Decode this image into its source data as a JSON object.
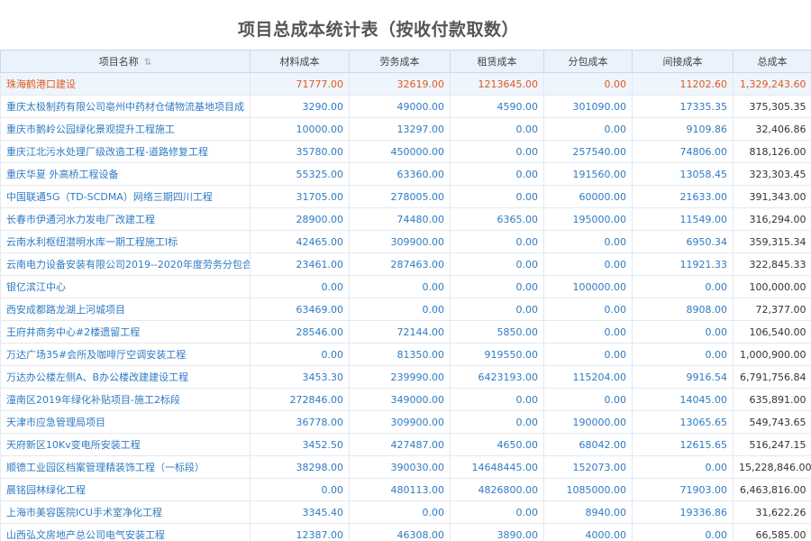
{
  "title": "项目总成本统计表（按收付款取数）",
  "columns": {
    "name": "项目名称",
    "material": "材料成本",
    "labor": "劳务成本",
    "rent": "租赁成本",
    "subcontract": "分包成本",
    "indirect": "间接成本",
    "total": "总成本"
  },
  "sort_icon": "sort-icon",
  "colors": {
    "link": "#2f7bc4",
    "highlight": "#e05a1e",
    "header_bg": "#eaf2fb"
  },
  "rows": [
    {
      "name": "珠海鹤港口建设",
      "material": "71777.00",
      "labor": "32619.00",
      "rent": "1213645.00",
      "subcontract": "0.00",
      "indirect": "11202.60",
      "total": "1,329,243.60",
      "highlight": true
    },
    {
      "name": "重庆太极制药有限公司亳州中药材仓储物流基地项目成",
      "material": "3290.00",
      "labor": "49000.00",
      "rent": "4590.00",
      "subcontract": "301090.00",
      "indirect": "17335.35",
      "total": "375,305.35"
    },
    {
      "name": "重庆市鹅岭公园绿化景观提升工程施工",
      "material": "10000.00",
      "labor": "13297.00",
      "rent": "0.00",
      "subcontract": "0.00",
      "indirect": "9109.86",
      "total": "32,406.86"
    },
    {
      "name": "重庆江北污水处理厂级改造工程-道路修复工程",
      "material": "35780.00",
      "labor": "450000.00",
      "rent": "0.00",
      "subcontract": "257540.00",
      "indirect": "74806.00",
      "total": "818,126.00"
    },
    {
      "name": "重庆华夏 外高桥工程设备",
      "material": "55325.00",
      "labor": "63360.00",
      "rent": "0.00",
      "subcontract": "191560.00",
      "indirect": "13058.45",
      "total": "323,303.45"
    },
    {
      "name": "中国联通5G（TD-SCDMA）网络三期四川工程",
      "material": "31705.00",
      "labor": "278005.00",
      "rent": "0.00",
      "subcontract": "60000.00",
      "indirect": "21633.00",
      "total": "391,343.00"
    },
    {
      "name": "长春市伊通河水力发电厂改建工程",
      "material": "28900.00",
      "labor": "74480.00",
      "rent": "6365.00",
      "subcontract": "195000.00",
      "indirect": "11549.00",
      "total": "316,294.00"
    },
    {
      "name": "云南水利枢纽潜明水库一期工程施工I标",
      "material": "42465.00",
      "labor": "309900.00",
      "rent": "0.00",
      "subcontract": "0.00",
      "indirect": "6950.34",
      "total": "359,315.34"
    },
    {
      "name": "云南电力设备安装有限公司2019--2020年度劳务分包合",
      "material": "23461.00",
      "labor": "287463.00",
      "rent": "0.00",
      "subcontract": "0.00",
      "indirect": "11921.33",
      "total": "322,845.33"
    },
    {
      "name": "银亿滨江中心",
      "material": "0.00",
      "labor": "0.00",
      "rent": "0.00",
      "subcontract": "100000.00",
      "indirect": "0.00",
      "total": "100,000.00"
    },
    {
      "name": "西安成都路龙湖上河城项目",
      "material": "63469.00",
      "labor": "0.00",
      "rent": "0.00",
      "subcontract": "0.00",
      "indirect": "8908.00",
      "total": "72,377.00"
    },
    {
      "name": "王府井商务中心#2楼遗留工程",
      "material": "28546.00",
      "labor": "72144.00",
      "rent": "5850.00",
      "subcontract": "0.00",
      "indirect": "0.00",
      "total": "106,540.00"
    },
    {
      "name": "万达广场35#会所及咖啡厅空调安装工程",
      "material": "0.00",
      "labor": "81350.00",
      "rent": "919550.00",
      "subcontract": "0.00",
      "indirect": "0.00",
      "total": "1,000,900.00"
    },
    {
      "name": "万达办公楼左侧A、B办公楼改建建设工程",
      "material": "3453.30",
      "labor": "239990.00",
      "rent": "6423193.00",
      "subcontract": "115204.00",
      "indirect": "9916.54",
      "total": "6,791,756.84"
    },
    {
      "name": "潼南区2019年绿化补贴项目-施工2标段",
      "material": "272846.00",
      "labor": "349000.00",
      "rent": "0.00",
      "subcontract": "0.00",
      "indirect": "14045.00",
      "total": "635,891.00"
    },
    {
      "name": "天津市应急管理局项目",
      "material": "36778.00",
      "labor": "309900.00",
      "rent": "0.00",
      "subcontract": "190000.00",
      "indirect": "13065.65",
      "total": "549,743.65"
    },
    {
      "name": "天府新区10Kv变电所安装工程",
      "material": "3452.50",
      "labor": "427487.00",
      "rent": "4650.00",
      "subcontract": "68042.00",
      "indirect": "12615.65",
      "total": "516,247.15"
    },
    {
      "name": "顺德工业园区档案管理精装饰工程（一标段）",
      "material": "38298.00",
      "labor": "390030.00",
      "rent": "14648445.00",
      "subcontract": "152073.00",
      "indirect": "0.00",
      "total": "15,228,846.00"
    },
    {
      "name": "晨铭园林绿化工程",
      "material": "0.00",
      "labor": "480113.00",
      "rent": "4826800.00",
      "subcontract": "1085000.00",
      "indirect": "71903.00",
      "total": "6,463,816.00"
    },
    {
      "name": "上海市美容医院ICU手术室净化工程",
      "material": "3345.40",
      "labor": "0.00",
      "rent": "0.00",
      "subcontract": "8940.00",
      "indirect": "19336.86",
      "total": "31,622.26"
    },
    {
      "name": "山西弘文房地产总公司电气安装工程",
      "material": "12387.00",
      "labor": "46308.00",
      "rent": "3890.00",
      "subcontract": "4000.00",
      "indirect": "0.00",
      "total": "66,585.00"
    }
  ]
}
